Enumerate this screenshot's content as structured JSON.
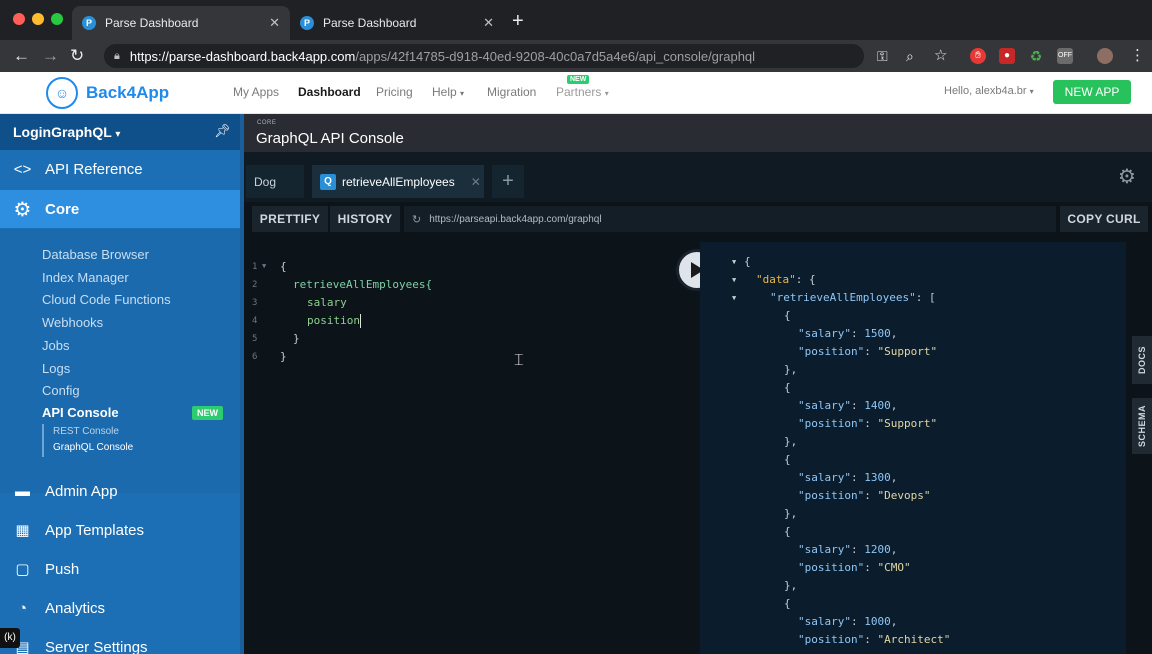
{
  "browser": {
    "tabs": [
      {
        "title": "Parse Dashboard",
        "active": true
      },
      {
        "title": "Parse Dashboard",
        "active": false
      }
    ],
    "url_host": "https://parse-dashboard.back4app.com",
    "url_path": "/apps/42f14785-d918-40ed-9208-40c0a7d5a4e6/api_console/graphql"
  },
  "header": {
    "brand": "Back4App",
    "nav": [
      "My Apps",
      "Dashboard",
      "Pricing",
      "Help",
      "Migration",
      "Partners"
    ],
    "partners_badge": "NEW",
    "user": "Hello, alexb4a.br",
    "new_app": "NEW APP"
  },
  "sidebar": {
    "app_name": "LoginGraphQL",
    "sections": [
      {
        "label": "API Reference",
        "icon": "code-icon"
      },
      {
        "label": "Core",
        "icon": "gear-icon"
      },
      {
        "label": "Admin App",
        "icon": "admin-icon"
      },
      {
        "label": "App Templates",
        "icon": "templates-icon"
      },
      {
        "label": "Push",
        "icon": "push-icon"
      },
      {
        "label": "Analytics",
        "icon": "analytics-icon"
      },
      {
        "label": "Server Settings",
        "icon": "server-icon"
      }
    ],
    "core_items": [
      "Database Browser",
      "Index Manager",
      "Cloud Code Functions",
      "Webhooks",
      "Jobs",
      "Logs",
      "Config",
      "API Console"
    ],
    "api_console_badge": "NEW",
    "console_items": [
      "REST Console",
      "GraphQL Console"
    ]
  },
  "main": {
    "section_tag": "CORE",
    "title": "GraphQL API Console",
    "tabs": [
      "Dog",
      "retrieveAllEmployees"
    ],
    "prettify": "PRETTIFY",
    "history": "HISTORY",
    "endpoint": "https://parseapi.back4app.com/graphql",
    "copy_curl": "COPY CURL",
    "docs": "DOCS",
    "schema": "SCHEMA",
    "query_lines": [
      "{",
      "retrieveAllEmployees{",
      "salary",
      "position",
      "}",
      "}"
    ],
    "line_numbers": [
      "1",
      "2",
      "3",
      "4",
      "5",
      "6"
    ],
    "result": {
      "root_key": "\"data\"",
      "list_key": "\"retrieveAllEmployees\"",
      "employees": [
        {
          "salary": "1500",
          "position": "\"Support\""
        },
        {
          "salary": "1400",
          "position": "\"Support\""
        },
        {
          "salary": "1300",
          "position": "\"Devops\""
        },
        {
          "salary": "1200",
          "position": "\"CMO\""
        },
        {
          "salary": "1000",
          "position": "\"Architect\""
        }
      ]
    }
  },
  "overlay": {
    "corner_label": "(k)"
  }
}
